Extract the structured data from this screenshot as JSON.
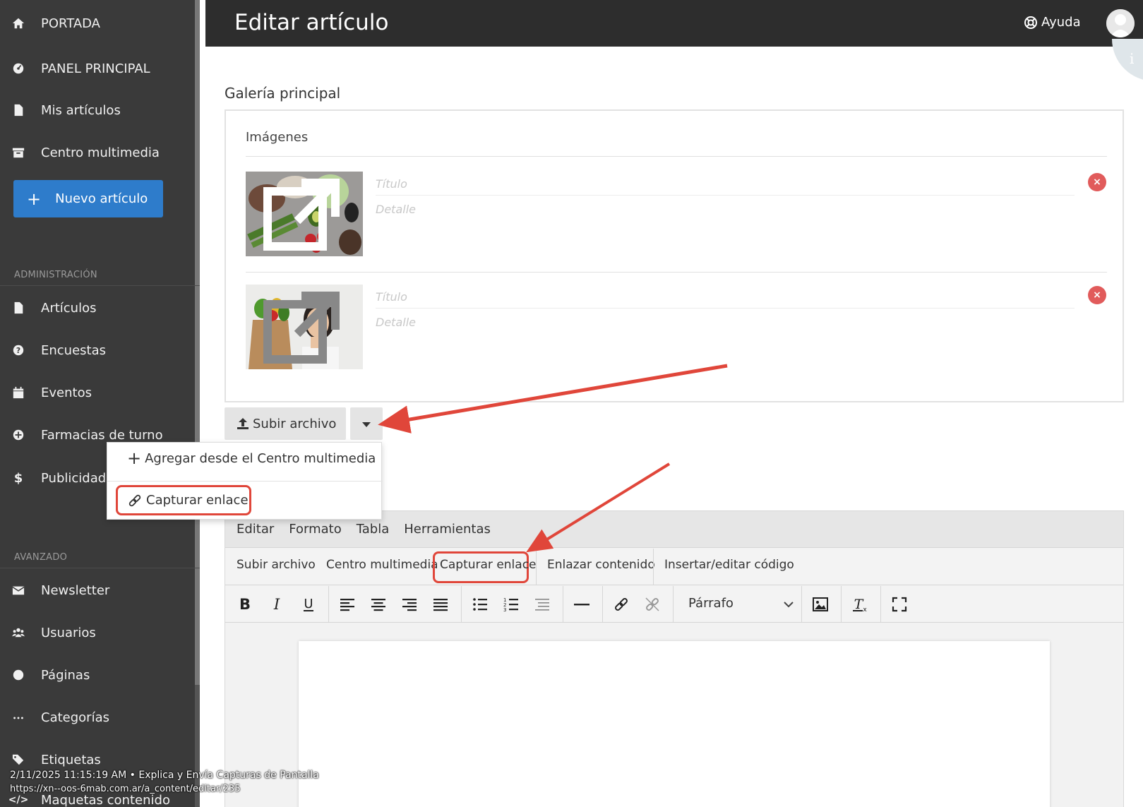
{
  "sidebar": {
    "top_items": [
      {
        "label": "PORTADA",
        "icon": "home-icon"
      },
      {
        "label": "PANEL PRINCIPAL",
        "icon": "dashboard-icon"
      },
      {
        "label": "Mis artículos",
        "icon": "file-icon"
      },
      {
        "label": "Centro multimedia",
        "icon": "archive-icon"
      }
    ],
    "new_article_label": "Nuevo artículo",
    "admin_label": "ADMINISTRACIÓN",
    "admin_items": [
      {
        "label": "Artículos",
        "icon": "file-icon"
      },
      {
        "label": "Encuestas",
        "icon": "question-icon"
      },
      {
        "label": "Eventos",
        "icon": "calendar-icon"
      },
      {
        "label": "Farmacias de turno",
        "icon": "plus-circle-icon"
      },
      {
        "label": "Publicidades",
        "icon": "dollar-icon"
      }
    ],
    "advanced_label": "AVANZADO",
    "advanced_items": [
      {
        "label": "Newsletter",
        "icon": "envelope-icon"
      },
      {
        "label": "Usuarios",
        "icon": "users-icon"
      },
      {
        "label": "Páginas",
        "icon": "circle-icon"
      },
      {
        "label": "Categorías",
        "icon": "ellipsis-icon"
      },
      {
        "label": "Etiquetas",
        "icon": "tags-icon"
      },
      {
        "label": "Maquetas contenido",
        "icon": "code-icon"
      }
    ]
  },
  "header": {
    "title": "Editar artículo",
    "help_label": "Ayuda",
    "info_glyph": "i"
  },
  "gallery": {
    "title": "Galería principal",
    "images_label": "Imágenes",
    "rows": [
      {
        "title_placeholder": "Título",
        "detail_placeholder": "Detalle",
        "remove_glyph": "×"
      },
      {
        "title_placeholder": "Título",
        "detail_placeholder": "Detalle",
        "remove_glyph": "×"
      }
    ],
    "upload_label": "Subir archivo"
  },
  "dropdown": {
    "add_label": "Agregar desde el Centro multimedia",
    "capture_label": "Capturar enlace"
  },
  "editor": {
    "menus": [
      "Editar",
      "Formato",
      "Tabla",
      "Herramientas"
    ],
    "custom_buttons": [
      "Subir archivo",
      "Centro multimedia",
      "Capturar enlace",
      "Enlazar contenido",
      "Insertar/editar código"
    ],
    "block_format": "Párrafo"
  },
  "stamp": {
    "line1": "2/11/2025 11:15:19 AM • Explica y Envía Capturas de Pantalla",
    "line2": "https://xn--oos-6mab.com.ar/a_content/editar/235"
  },
  "colors": {
    "sidebar_bg": "#3a3a3a",
    "topbar_bg": "#2d2d2d",
    "accent_blue": "#2e7ccb",
    "highlight_red": "#e0463a",
    "remove_red": "#e15b5b"
  }
}
